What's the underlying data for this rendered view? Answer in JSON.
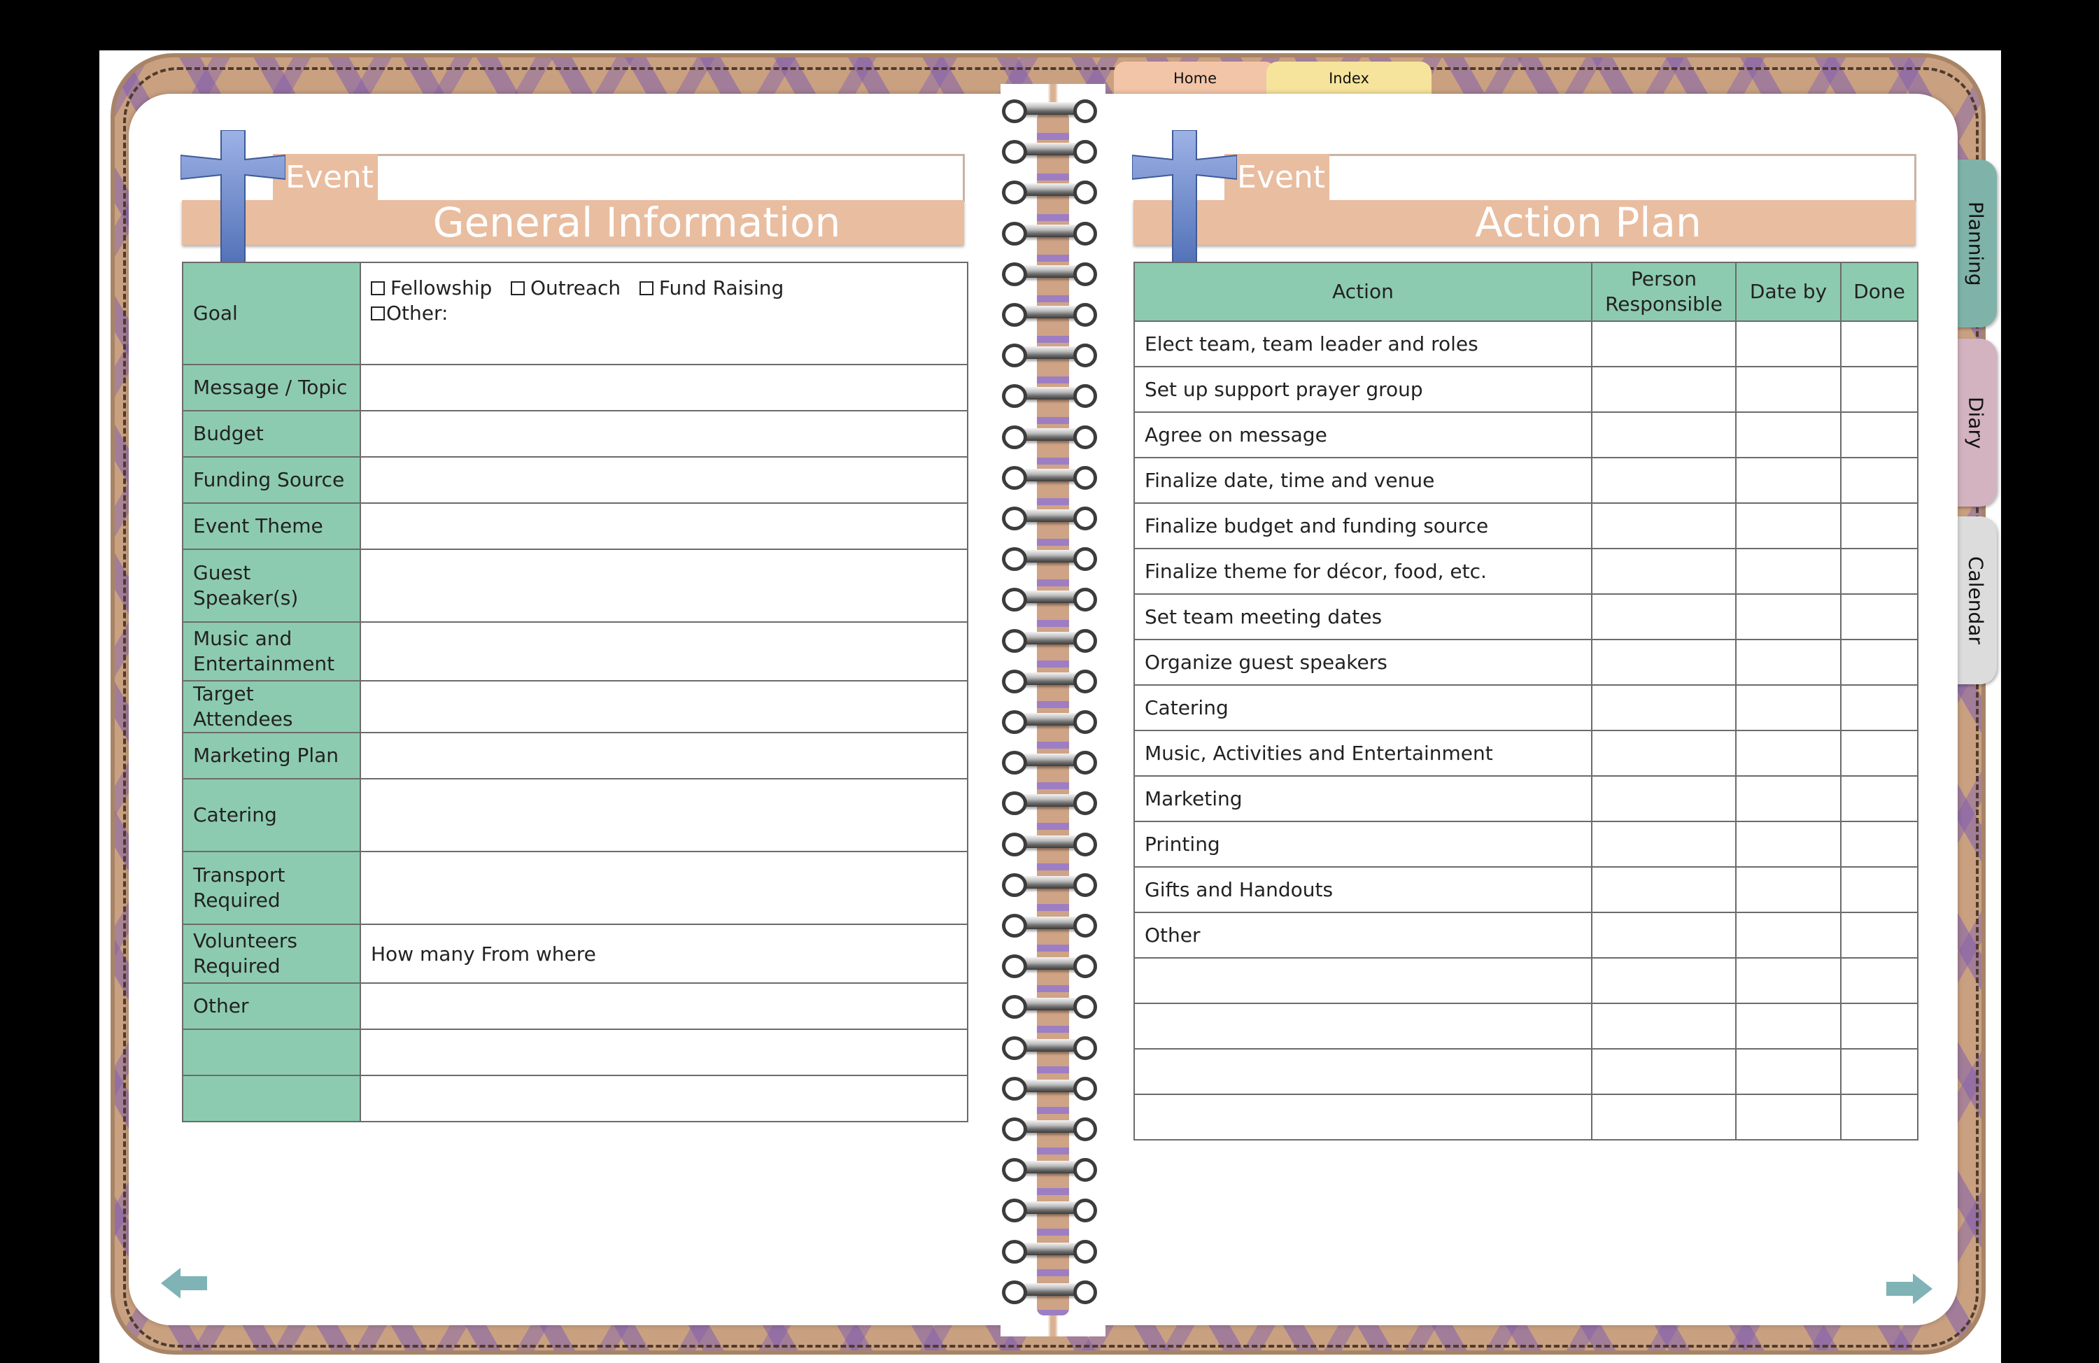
{
  "top_tabs": {
    "home": "Home",
    "index": "Index"
  },
  "side_tabs": {
    "planning": "Planning",
    "diary": "Diary",
    "calendar": "Calendar"
  },
  "left_page": {
    "header": {
      "small": "Event",
      "title": "General Information"
    },
    "goal": {
      "label": "Goal",
      "options": [
        "Fellowship",
        "Outreach",
        "Fund Raising"
      ],
      "other": "Other:"
    },
    "rows": [
      {
        "label": "Message / Topic",
        "value": ""
      },
      {
        "label": "Budget",
        "value": ""
      },
      {
        "label": "Funding Source",
        "value": ""
      },
      {
        "label": "Event Theme",
        "value": ""
      },
      {
        "label": "Guest Speaker(s)",
        "value": ""
      },
      {
        "label": "Music and Entertainment",
        "value": ""
      },
      {
        "label": "Target Attendees",
        "value": ""
      },
      {
        "label": "Marketing Plan",
        "value": ""
      },
      {
        "label": "Catering",
        "value": ""
      },
      {
        "label": "Transport Required",
        "value": ""
      },
      {
        "label": "Volunteers Required",
        "value": "How many  From where"
      },
      {
        "label": "Other",
        "value": ""
      },
      {
        "label": "",
        "value": ""
      },
      {
        "label": "",
        "value": ""
      }
    ]
  },
  "right_page": {
    "header": {
      "small": "Event",
      "title": "Action Plan"
    },
    "columns": [
      "Action",
      "Person Responsible",
      "Date by",
      "Done"
    ],
    "actions": [
      "Elect team, team leader and roles",
      "Set up support prayer group",
      "Agree on message",
      "Finalize date, time and venue",
      "Finalize budget and funding source",
      "Finalize theme for décor, food, etc.",
      "Set team meeting dates",
      "Organize guest speakers",
      "Catering",
      "Music, Activities and Entertainment",
      "Marketing",
      "Printing",
      "Gifts and Handouts",
      "Other",
      "",
      "",
      "",
      ""
    ]
  },
  "nav": {
    "prev_icon": "arrow-left-icon",
    "next_icon": "arrow-right-icon"
  },
  "colors": {
    "label_bg": "#8dcbb0",
    "header_band": "#e9bda0",
    "cross": "#6f8fcf"
  }
}
